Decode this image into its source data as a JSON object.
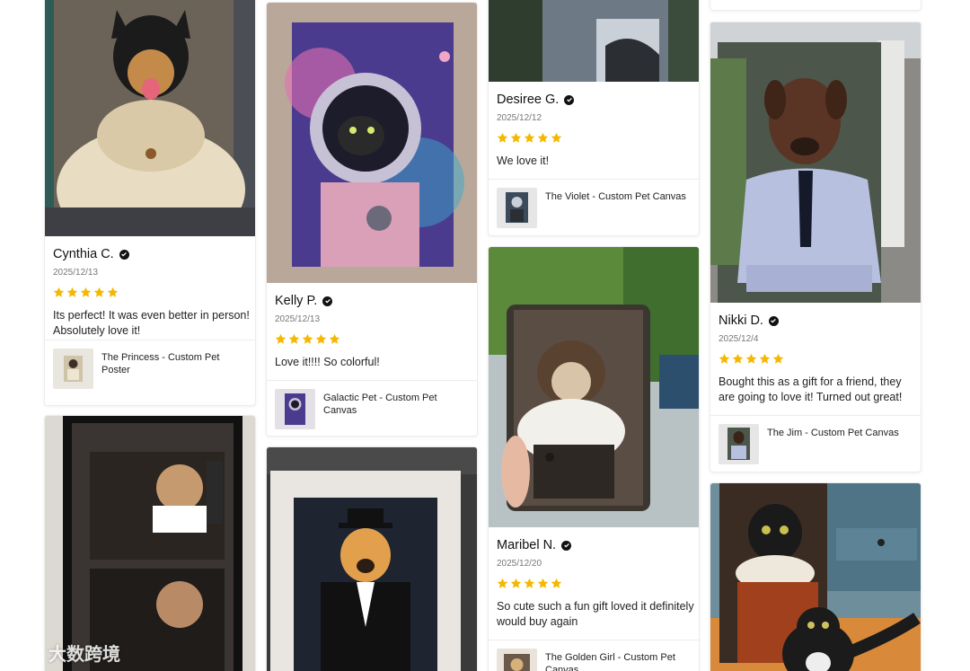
{
  "reviews": [
    {
      "name": "Cynthia C.",
      "date": "2025/12/13",
      "rating": 5,
      "text": "Its perfect! It was even better in person! Absolutely love it!",
      "product": "The Princess - Custom Pet Poster"
    },
    {
      "name": "Kelly P.",
      "date": "2025/12/13",
      "rating": 5,
      "text": "Love it!!!! So colorful!",
      "product": "Galactic Pet - Custom Pet Canvas"
    },
    {
      "name": "Desiree G.",
      "date": "2025/12/12",
      "rating": 5,
      "text": "We love it!",
      "product": "The Violet - Custom Pet Canvas"
    },
    {
      "name": "Nikki D.",
      "date": "2025/12/4",
      "rating": 5,
      "text": "Bought this as a gift for a friend, they are going to love it! Turned out great!",
      "product": "The Jim - Custom Pet Canvas"
    },
    {
      "name": "Maribel N.",
      "date": "2025/12/20",
      "rating": 5,
      "text": "So cute such a fun gift loved it definitely would buy again",
      "product": "The Golden Girl - Custom Pet Canvas"
    }
  ],
  "colors": {
    "star": "#f5b800",
    "border": "#ececec",
    "verified": "#111111"
  },
  "watermark": {
    "text": "大数跨境"
  }
}
